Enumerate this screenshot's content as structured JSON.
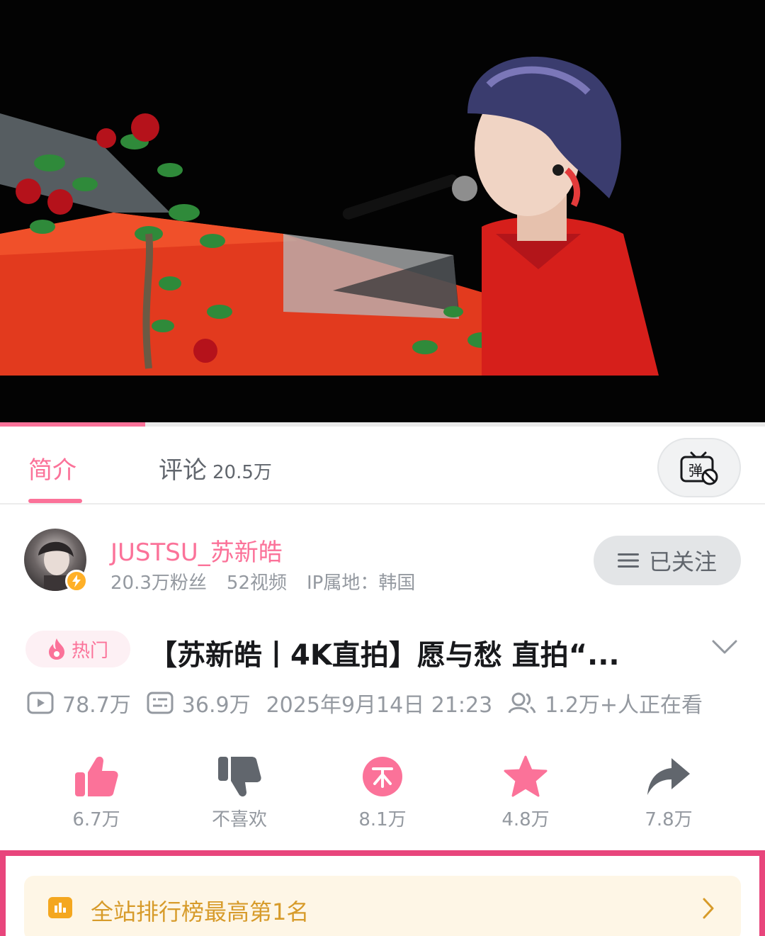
{
  "tabs": [
    {
      "label": "简介",
      "count": ""
    },
    {
      "label": "评论",
      "count": "20.5万"
    }
  ],
  "player": {
    "progress_fraction": 0.19
  },
  "uploader": {
    "name": "JUSTSU_苏新皓",
    "fans": "20.3万粉丝",
    "videos": "52视频",
    "ip": "IP属地：韩国",
    "follow_label": "已关注"
  },
  "video": {
    "hot_label": "热门",
    "title": "【苏新皓丨4K直拍】愿与愁 直拍“...",
    "views": "78.7万",
    "danmaku": "36.9万",
    "date": "2025年9月14日 21:23",
    "watching": "1.2万+人正在看"
  },
  "actions": [
    {
      "icon": "thumbs-up-icon",
      "label": "6.7万"
    },
    {
      "icon": "thumbs-down-icon",
      "label": "不喜欢"
    },
    {
      "icon": "coin-icon",
      "label": "8.1万"
    },
    {
      "icon": "star-icon",
      "label": "4.8万"
    },
    {
      "icon": "share-icon",
      "label": "7.8万"
    }
  ],
  "ranking": {
    "label": "全站排行榜最高第1名"
  },
  "colors": {
    "accent": "#fb7299",
    "gold": "#d79b2a",
    "highlight_frame": "#e8457c"
  }
}
